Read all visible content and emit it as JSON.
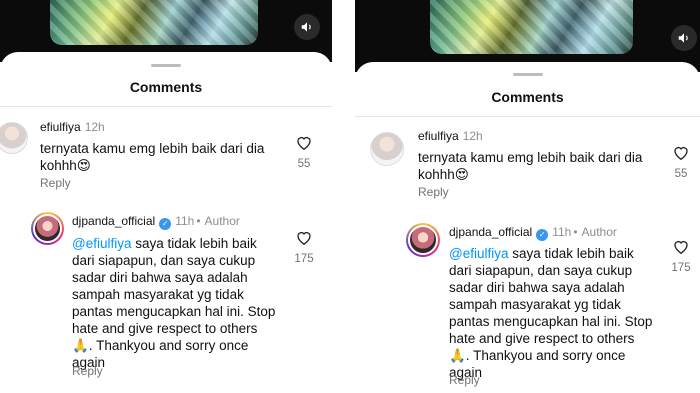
{
  "sheet": {
    "title": "Comments"
  },
  "comments": [
    {
      "username": "efiulfiya",
      "time": "12h",
      "text": "ternyata kamu emg lebih baik dari dia kohhh😍",
      "reply_label": "Reply",
      "likes": "55"
    },
    {
      "username": "djpanda_official",
      "time": "11h",
      "author_tag": "Author",
      "mention": "@efiulfiya",
      "text": " saya tidak lebih baik dari siapapun, dan saya cukup sadar diri bahwa saya adalah sampah masyarakat yg tidak pantas mengucapkan hal ini. Stop hate and give respect to others 🙏. Thankyou and sorry once again",
      "reply_label": "Reply",
      "likes": "175"
    }
  ],
  "icons": {
    "sound": "speaker-icon",
    "like": "heart-icon",
    "verified": "verified-badge-icon"
  },
  "colors": {
    "mention": "#0095f6",
    "verified": "#3897f0",
    "muted": "#737373"
  }
}
